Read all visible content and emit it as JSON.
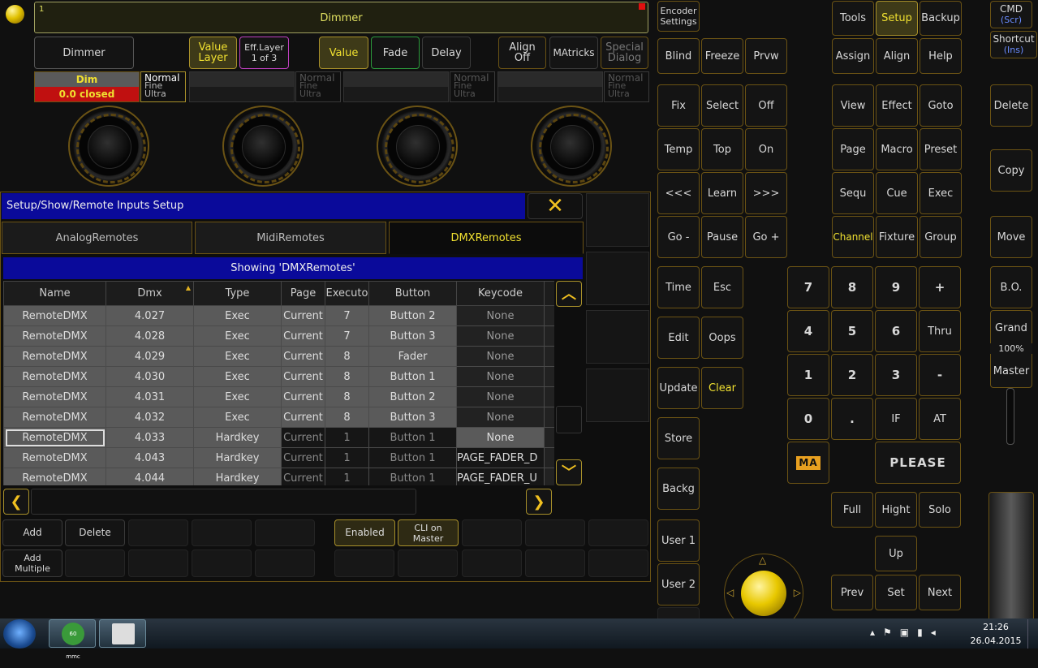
{
  "top_fader": {
    "number": "1",
    "title": "Dimmer"
  },
  "attr_row": {
    "attribute": "Dimmer",
    "value_layer": "Value\nLayer",
    "eff_layer": "Eff.Layer\n1 of 3",
    "value": "Value",
    "fade": "Fade",
    "delay": "Delay",
    "align": "Align\nOff",
    "matricks": "MAtricks",
    "special_dialog": "Special\nDialog"
  },
  "encoders": [
    {
      "name": "Dim",
      "value": "0.0 closed",
      "res": [
        "Normal",
        "Fine",
        "Ultra"
      ]
    },
    {
      "name": "",
      "value": "",
      "res": [
        "Normal",
        "Fine",
        "Ultra"
      ]
    },
    {
      "name": "",
      "value": "",
      "res": [
        "Normal",
        "Fine",
        "Ultra"
      ]
    },
    {
      "name": "",
      "value": "",
      "res": [
        "Normal",
        "Fine",
        "Ultra"
      ]
    }
  ],
  "window": {
    "title": "Setup/Show/Remote Inputs Setup",
    "tabs": [
      "AnalogRemotes",
      "MidiRemotes",
      "DMXRemotes"
    ],
    "showing": "Showing 'DMXRemotes'",
    "columns": [
      "Name",
      "Dmx",
      "Type",
      "Page",
      "Executo",
      "Button",
      "Keycode"
    ],
    "rows": [
      [
        "RemoteDMX",
        "4.027",
        "Exec",
        "Current",
        "7",
        "Button 2",
        "None"
      ],
      [
        "RemoteDMX",
        "4.028",
        "Exec",
        "Current",
        "7",
        "Button 3",
        "None"
      ],
      [
        "RemoteDMX",
        "4.029",
        "Exec",
        "Current",
        "8",
        "Fader",
        "None"
      ],
      [
        "RemoteDMX",
        "4.030",
        "Exec",
        "Current",
        "8",
        "Button 1",
        "None"
      ],
      [
        "RemoteDMX",
        "4.031",
        "Exec",
        "Current",
        "8",
        "Button 2",
        "None"
      ],
      [
        "RemoteDMX",
        "4.032",
        "Exec",
        "Current",
        "8",
        "Button 3",
        "None"
      ],
      [
        "RemoteDMX",
        "4.033",
        "Hardkey",
        "Current",
        "1",
        "Button 1",
        "None"
      ],
      [
        "RemoteDMX",
        "4.043",
        "Hardkey",
        "Current",
        "1",
        "Button 1",
        "PAGE_FADER_D"
      ],
      [
        "RemoteDMX",
        "4.044",
        "Hardkey",
        "Current",
        "1",
        "Button 1",
        "PAGE_FADER_U"
      ]
    ],
    "bottom": {
      "add": "Add",
      "delete": "Delete",
      "add_multiple": "Add\nMultiple",
      "enabled": "Enabled",
      "cli_master": "CLI on\nMaster"
    }
  },
  "console": {
    "encoder_settings": "Encoder\nSettings",
    "tools": "Tools",
    "setup": "Setup",
    "backup": "Backup",
    "cmd": "CMD",
    "cmd_sub": "(Scr)",
    "shortcut": "Shortcut",
    "shortcut_sub": "(Ins)",
    "blind": "Blind",
    "freeze": "Freeze",
    "prvw": "Prvw",
    "assign": "Assign",
    "align": "Align",
    "help": "Help",
    "fix": "Fix",
    "select": "Select",
    "off": "Off",
    "view": "View",
    "effect": "Effect",
    "goto": "Goto",
    "delete": "Delete",
    "temp": "Temp",
    "top": "Top",
    "on": "On",
    "page": "Page",
    "macro": "Macro",
    "preset": "Preset",
    "copy": "Copy",
    "prev_seq": "<<<",
    "learn": "Learn",
    "next_seq": ">>>",
    "sequ": "Sequ",
    "cue": "Cue",
    "exec": "Exec",
    "go_minus": "Go -",
    "pause": "Pause",
    "go_plus": "Go +",
    "channel": "Channel",
    "fixture": "Fixture",
    "group": "Group",
    "move": "Move",
    "time": "Time",
    "esc": "Esc",
    "edit": "Edit",
    "oops": "Oops",
    "update": "Update",
    "clear": "Clear",
    "store": "Store",
    "backg": "Backg",
    "user1": "User 1",
    "user2": "User 2",
    "bo": "B.O.",
    "grand": "Grand",
    "grand_level": "100%",
    "master": "Master",
    "keys": [
      "7",
      "8",
      "9",
      "+",
      "4",
      "5",
      "6",
      "Thru",
      "1",
      "2",
      "3",
      "-",
      "0",
      ".",
      "IF",
      "AT"
    ],
    "please": "PLEASE",
    "ma_logo": "MA",
    "full": "Full",
    "hight": "Hight",
    "solo": "Solo",
    "up": "Up",
    "prev": "Prev",
    "set": "Set",
    "next": "Next"
  },
  "taskbar": {
    "time": "21:26",
    "date": "26.04.2015",
    "app1": "60 mmc"
  }
}
